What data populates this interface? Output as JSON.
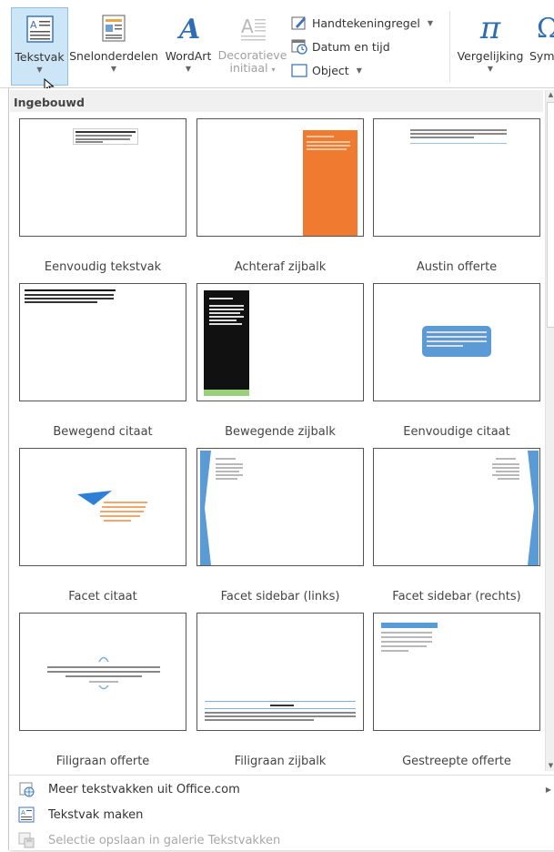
{
  "ribbon": {
    "tekstvak": {
      "label": "Tekstvak",
      "icon": "textbox-icon"
    },
    "snelonderdelen": {
      "label": "Snelonderdelen",
      "icon": "quick-parts-icon"
    },
    "wordart": {
      "label": "WordArt",
      "icon": "wordart-icon"
    },
    "decoratieve": {
      "label_line1": "Decoratieve",
      "label_line2": "initiaal",
      "icon": "drop-cap-icon"
    },
    "handtekeningregel": {
      "label": "Handtekeningregel",
      "icon": "signature-line-icon"
    },
    "datum": {
      "label": "Datum en tijd",
      "icon": "date-time-icon"
    },
    "object": {
      "label": "Object",
      "icon": "object-icon"
    },
    "vergelijking": {
      "label": "Vergelijking",
      "icon": "pi-icon"
    },
    "symbool": {
      "label": "Sym",
      "icon": "omega-icon"
    }
  },
  "gallery": {
    "group_header": "Ingebouwd",
    "items": [
      {
        "caption": "Eenvoudig tekstvak"
      },
      {
        "caption": "Achteraf zijbalk"
      },
      {
        "caption": "Austin offerte"
      },
      {
        "caption": "Bewegend citaat"
      },
      {
        "caption": "Bewegende zijbalk"
      },
      {
        "caption": "Eenvoudige citaat"
      },
      {
        "caption": "Facet citaat"
      },
      {
        "caption": "Facet sidebar (links)"
      },
      {
        "caption": "Facet sidebar (rechts)"
      },
      {
        "caption": "Filigraan offerte"
      },
      {
        "caption": "Filigraan zijbalk"
      },
      {
        "caption": "Gestreepte offerte"
      }
    ]
  },
  "menu": {
    "meer": {
      "label": "Meer tekstvakken uit Office.com",
      "icon": "office-com-icon"
    },
    "maken": {
      "label": "Tekstvak maken",
      "icon": "draw-textbox-icon"
    },
    "opslaan": {
      "label": "Selectie opslaan in galerie Tekstvakken",
      "icon": "save-selection-icon"
    }
  },
  "colors": {
    "accent_orange": "#ef7a30",
    "accent_blue": "#5b9bd5",
    "bright_blue": "#2e7fd6",
    "pressed_bg": "#cde6f7",
    "green_bar": "#9bd07a"
  }
}
